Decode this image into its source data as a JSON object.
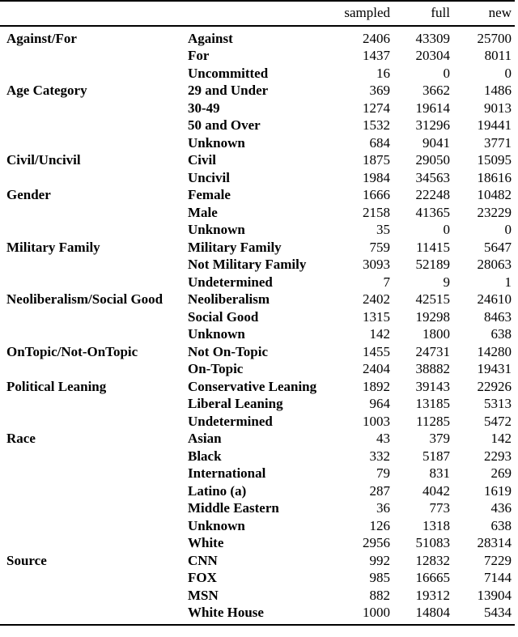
{
  "table": {
    "columns": {
      "group_header": "",
      "level_header": "",
      "sampled": "sampled",
      "full": "full",
      "new": "new"
    },
    "rows": [
      {
        "group": "Against/For",
        "level": "Against",
        "sampled": "2406",
        "full": "43309",
        "new": "25700"
      },
      {
        "group": "",
        "level": "For",
        "sampled": "1437",
        "full": "20304",
        "new": "8011"
      },
      {
        "group": "",
        "level": "Uncommitted",
        "sampled": "16",
        "full": "0",
        "new": "0"
      },
      {
        "group": "Age Category",
        "level": "29 and Under",
        "sampled": "369",
        "full": "3662",
        "new": "1486"
      },
      {
        "group": "",
        "level": "30-49",
        "sampled": "1274",
        "full": "19614",
        "new": "9013"
      },
      {
        "group": "",
        "level": "50 and Over",
        "sampled": "1532",
        "full": "31296",
        "new": "19441"
      },
      {
        "group": "",
        "level": "Unknown",
        "sampled": "684",
        "full": "9041",
        "new": "3771"
      },
      {
        "group": "Civil/Uncivil",
        "level": "Civil",
        "sampled": "1875",
        "full": "29050",
        "new": "15095"
      },
      {
        "group": "",
        "level": "Uncivil",
        "sampled": "1984",
        "full": "34563",
        "new": "18616"
      },
      {
        "group": "Gender",
        "level": "Female",
        "sampled": "1666",
        "full": "22248",
        "new": "10482"
      },
      {
        "group": "",
        "level": "Male",
        "sampled": "2158",
        "full": "41365",
        "new": "23229"
      },
      {
        "group": "",
        "level": "Unknown",
        "sampled": "35",
        "full": "0",
        "new": "0"
      },
      {
        "group": "Military Family",
        "level": "Military Family",
        "sampled": "759",
        "full": "11415",
        "new": "5647"
      },
      {
        "group": "",
        "level": "Not Military Family",
        "sampled": "3093",
        "full": "52189",
        "new": "28063"
      },
      {
        "group": "",
        "level": "Undetermined",
        "sampled": "7",
        "full": "9",
        "new": "1"
      },
      {
        "group": "Neoliberalism/Social Good",
        "level": "Neoliberalism",
        "sampled": "2402",
        "full": "42515",
        "new": "24610"
      },
      {
        "group": "",
        "level": "Social Good",
        "sampled": "1315",
        "full": "19298",
        "new": "8463"
      },
      {
        "group": "",
        "level": "Unknown",
        "sampled": "142",
        "full": "1800",
        "new": "638"
      },
      {
        "group": "OnTopic/Not-OnTopic",
        "level": "Not On-Topic",
        "sampled": "1455",
        "full": "24731",
        "new": "14280"
      },
      {
        "group": "",
        "level": "On-Topic",
        "sampled": "2404",
        "full": "38882",
        "new": "19431"
      },
      {
        "group": "Political Leaning",
        "level": "Conservative Leaning",
        "sampled": "1892",
        "full": "39143",
        "new": "22926"
      },
      {
        "group": "",
        "level": "Liberal Leaning",
        "sampled": "964",
        "full": "13185",
        "new": "5313"
      },
      {
        "group": "",
        "level": "Undetermined",
        "sampled": "1003",
        "full": "11285",
        "new": "5472"
      },
      {
        "group": "Race",
        "level": "Asian",
        "sampled": "43",
        "full": "379",
        "new": "142"
      },
      {
        "group": "",
        "level": "Black",
        "sampled": "332",
        "full": "5187",
        "new": "2293"
      },
      {
        "group": "",
        "level": "International",
        "sampled": "79",
        "full": "831",
        "new": "269"
      },
      {
        "group": "",
        "level": "Latino (a)",
        "sampled": "287",
        "full": "4042",
        "new": "1619"
      },
      {
        "group": "",
        "level": "Middle Eastern",
        "sampled": "36",
        "full": "773",
        "new": "436"
      },
      {
        "group": "",
        "level": "Unknown",
        "sampled": "126",
        "full": "1318",
        "new": "638"
      },
      {
        "group": "",
        "level": "White",
        "sampled": "2956",
        "full": "51083",
        "new": "28314"
      },
      {
        "group": "Source",
        "level": "CNN",
        "sampled": "992",
        "full": "12832",
        "new": "7229"
      },
      {
        "group": "",
        "level": "FOX",
        "sampled": "985",
        "full": "16665",
        "new": "7144"
      },
      {
        "group": "",
        "level": "MSN",
        "sampled": "882",
        "full": "19312",
        "new": "13904"
      },
      {
        "group": "",
        "level": "White House",
        "sampled": "1000",
        "full": "14804",
        "new": "5434"
      }
    ]
  }
}
